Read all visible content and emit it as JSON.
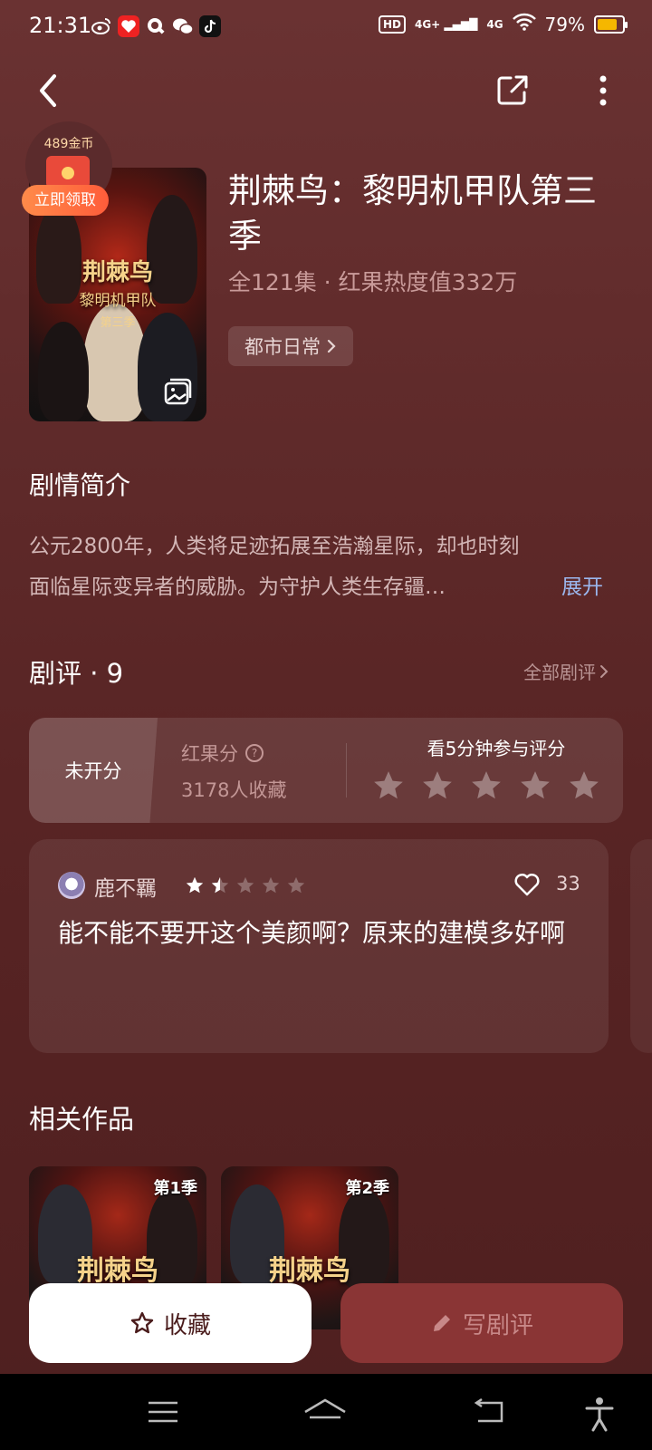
{
  "status_bar": {
    "time": "21:31",
    "battery": "79%",
    "battery_level": 0.79,
    "hd": "HD",
    "signal1": "4G+",
    "signal2": "4G"
  },
  "promo": {
    "coins": "489金币",
    "claim_label": "立即领取"
  },
  "drama": {
    "title": "荆棘鸟：黎明机甲队第三季",
    "meta": "全121集 · 红果热度值332万",
    "genre": "都市日常"
  },
  "poster": {
    "title": "荆棘鸟",
    "subtitle": "黎明机甲队",
    "season": "第三季"
  },
  "synopsis": {
    "heading": "剧情简介",
    "line1": "公元2800年，人类将足迹拓展至浩瀚星际，却也时刻",
    "line2": "面临星际变异者的威胁。为守护人类生存疆…",
    "expand": "展开"
  },
  "reviews": {
    "heading": "剧评 · 9",
    "all_link": "全部剧评",
    "rating": {
      "unrated": "未开分",
      "score_label": "红果分",
      "help": "?",
      "collect_count": "3178人收藏",
      "prompt": "看5分钟参与评分",
      "stars_total": 5
    },
    "items": [
      {
        "author": "鹿不羈",
        "stars": 1.5,
        "likes": "33",
        "text": "能不能不要开这个美颜啊？原来的建模多好啊"
      }
    ]
  },
  "related": {
    "heading": "相关作品",
    "items": [
      {
        "badge": "第1季",
        "title": "荆棘鸟"
      },
      {
        "badge": "第2季",
        "title": "荆棘鸟"
      }
    ]
  },
  "actions": {
    "favorite": "收藏",
    "write_review": "写剧评"
  },
  "colors": {
    "background": "#5f2a2a",
    "accent_link": "#9bb7ee",
    "claim": "#ff6a3d",
    "write_button": "#8a3535"
  }
}
